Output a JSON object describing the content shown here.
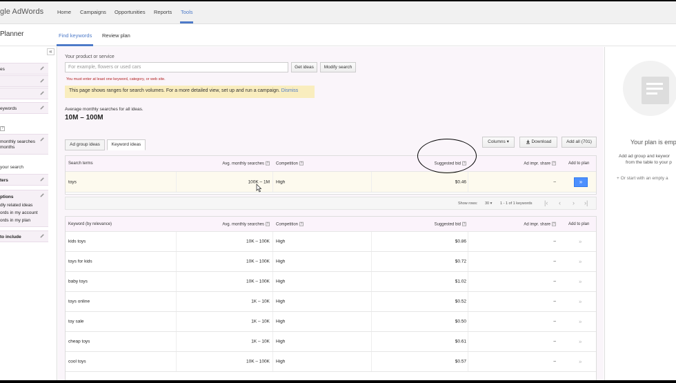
{
  "brand": "gle AdWords",
  "topnav": {
    "items": [
      "Home",
      "Campaigns",
      "Opportunities",
      "Reports",
      "Tools"
    ],
    "active": "Tools"
  },
  "subnav": {
    "title": "Planner",
    "tabs": [
      "Find keywords",
      "Review plan"
    ]
  },
  "sidebar": {
    "items": [
      "es",
      "",
      "",
      "eywords"
    ],
    "targeting_text": [
      "monthly searches",
      "months"
    ],
    "search_label": "your search",
    "filters_label": "ters",
    "options_label": "ptions",
    "options_items": [
      "dly related ideas",
      "ords in my account",
      "ords in my plan"
    ],
    "include_label": "to include",
    "collapse": "«"
  },
  "search": {
    "label": "Your product or service",
    "placeholder": "For example, flowers or used cars",
    "get_ideas": "Get ideas",
    "modify": "Modify search",
    "error": "You must enter at least one keyword, category, or web site."
  },
  "notice": {
    "text": "This page shows ranges for search volumes. For a more detailed view, set up and run a campaign.",
    "dismiss": "Dismiss"
  },
  "summary": {
    "label": "Average monthly searches for all ideas.",
    "value": "10M – 100M"
  },
  "tabs": [
    "Ad group ideas",
    "Keyword ideas"
  ],
  "actions": {
    "columns": "Columns",
    "download": "Download",
    "add_all": "Add all (701)"
  },
  "search_terms_table": {
    "headers": [
      "Search terms",
      "Avg. monthly searches",
      "Competition",
      "Suggested bid",
      "Ad impr. share",
      "Add to plan"
    ],
    "rows": [
      {
        "term": "toys",
        "searches": "100K – 1M",
        "competition": "High",
        "bid": "$0.46",
        "share": "–"
      }
    ]
  },
  "pager": {
    "show_rows_label": "Show rows:",
    "rows": "30",
    "range": "1 - 1 of 1 keywords"
  },
  "keyword_table": {
    "headers": [
      "Keyword (by relevance)",
      "Avg. monthly searches",
      "Competition",
      "Suggested bid",
      "Ad impr. share",
      "Add to plan"
    ],
    "rows": [
      {
        "term": "kids toys",
        "searches": "10K – 100K",
        "competition": "High",
        "bid": "$0.86",
        "share": "–"
      },
      {
        "term": "toys for kids",
        "searches": "10K – 100K",
        "competition": "High",
        "bid": "$0.72",
        "share": "–"
      },
      {
        "term": "baby toys",
        "searches": "10K – 100K",
        "competition": "High",
        "bid": "$1.02",
        "share": "–"
      },
      {
        "term": "toys online",
        "searches": "1K – 10K",
        "competition": "High",
        "bid": "$0.52",
        "share": "–"
      },
      {
        "term": "toy sale",
        "searches": "1K – 10K",
        "competition": "High",
        "bid": "$0.50",
        "share": "–"
      },
      {
        "term": "cheap toys",
        "searches": "1K – 10K",
        "competition": "High",
        "bid": "$0.61",
        "share": "–"
      },
      {
        "term": "cool toys",
        "searches": "10K – 100K",
        "competition": "High",
        "bid": "$0.57",
        "share": "–"
      }
    ]
  },
  "plan_panel": {
    "title": "Your plan is emp",
    "lines": [
      "Add ad group and keywor",
      "from the table to your p"
    ],
    "start_text": "+ Or start with an empty a"
  },
  "colors": {
    "accent": "#4d7ac8",
    "add_button": "#4d90fe",
    "notice_bg": "#f9edbe"
  },
  "icons": [
    "pencil-icon",
    "question-icon",
    "download-icon",
    "dropdown-arrow-icon",
    "double-chevron-icon",
    "plan-document-icon"
  ]
}
